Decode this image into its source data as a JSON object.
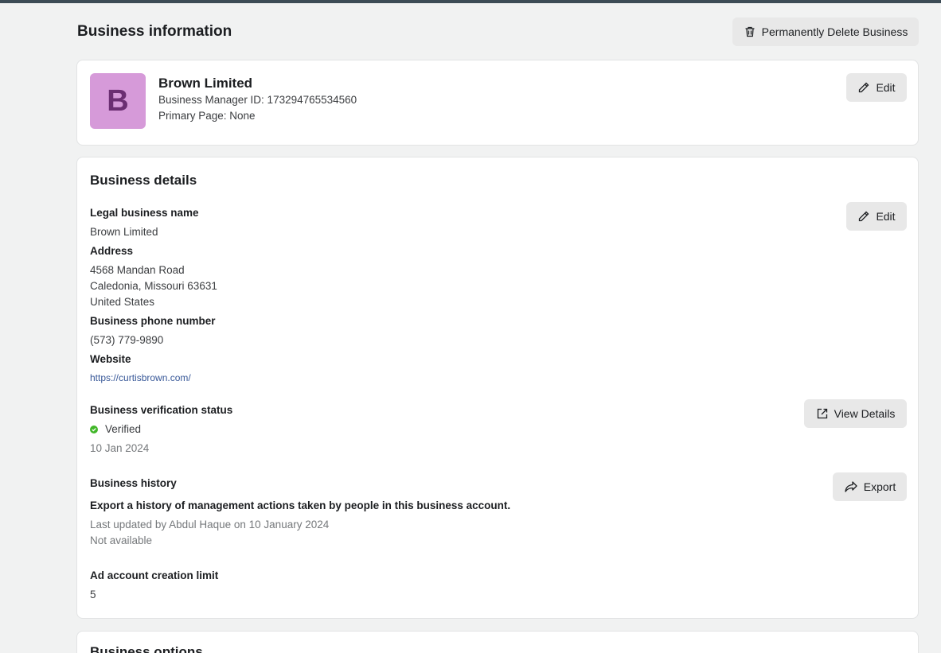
{
  "header": {
    "title": "Business information",
    "delete_button": "Permanently Delete Business"
  },
  "profile": {
    "logo_letter": "B",
    "name": "Brown Limited",
    "manager_id": "Business Manager ID: 173294765534560",
    "primary_page": "Primary Page: None",
    "edit_button": "Edit"
  },
  "details": {
    "title": "Business details",
    "edit_button": "Edit",
    "legal_name_label": "Legal business name",
    "legal_name": "Brown Limited",
    "address_label": "Address",
    "address_line1": "4568 Mandan Road",
    "address_line2": "Caledonia, Missouri 63631",
    "address_line3": "United States",
    "phone_label": "Business phone number",
    "phone": "(573) 779-9890",
    "website_label": "Website",
    "website": "https://curtisbrown.com/",
    "verification_label": "Business verification status",
    "verification_status": "Verified",
    "verification_date": "10 Jan 2024",
    "view_details_button": "View Details",
    "history_label": "Business history",
    "history_description": "Export a history of management actions taken by people in this business account.",
    "history_updated": "Last updated by Abdul Haque on 10 January 2024",
    "history_status": "Not available",
    "export_button": "Export",
    "ad_limit_label": "Ad account creation limit",
    "ad_limit": "5"
  },
  "options": {
    "title": "Business options"
  },
  "colors": {
    "verified": "#42b72a",
    "link": "#385898",
    "logo_bg": "#d69ad9"
  },
  "icons": {
    "delete": "trash-icon",
    "edit": "pencil-icon",
    "view_details": "external-link-icon",
    "export": "share-arrow-icon",
    "verified": "check-circle-icon"
  }
}
